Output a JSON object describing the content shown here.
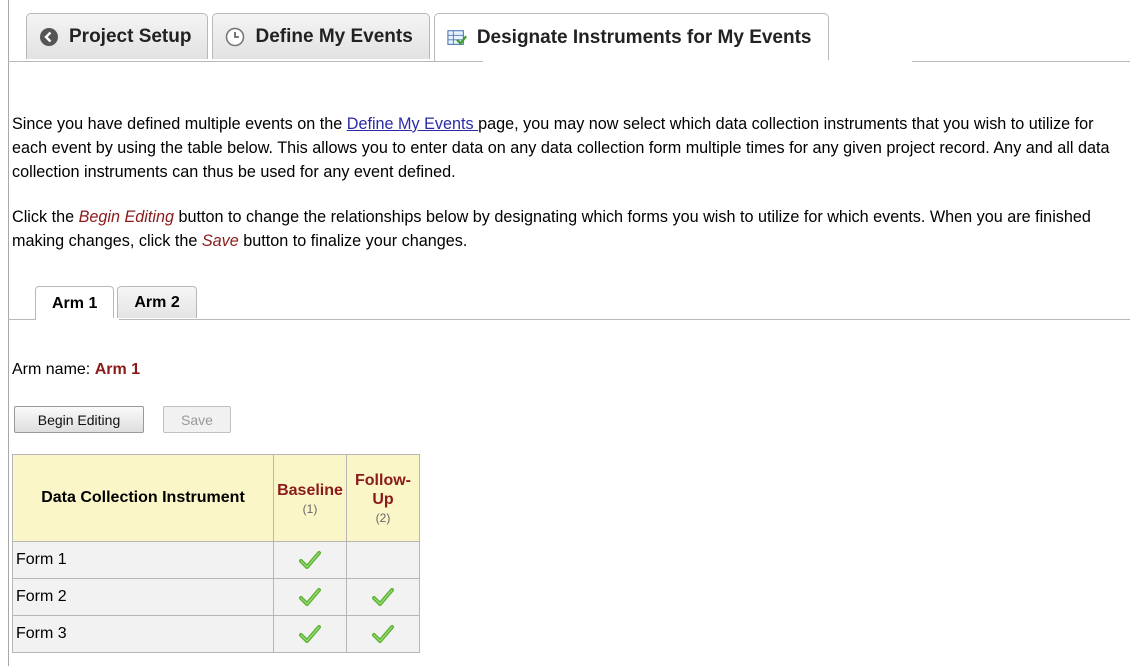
{
  "top_tabs": [
    {
      "label": "Project Setup",
      "icon": "arrow-left-circle-icon"
    },
    {
      "label": "Define My Events",
      "icon": "clock-icon"
    },
    {
      "label": "Designate Instruments for My Events",
      "icon": "instrument-grid-icon",
      "active": true
    }
  ],
  "intro": {
    "p1_before": "Since you have defined multiple events on the ",
    "p1_link": "Define My Events ",
    "p1_after": "page, you may now select which data collection instruments that you wish to utilize for each event by using the table below. This allows you to enter data on any data collection form multiple times for any given project record. Any and all data collection instruments can thus be used for any event defined.",
    "p2_a": "Click the ",
    "p2_em1": "Begin Editing",
    "p2_b": " button to change the relationships below by designating which forms you wish to utilize for which events. When you are finished making changes, click the ",
    "p2_em2": "Save",
    "p2_c": " button to finalize your changes."
  },
  "arm_tabs": [
    {
      "label": "Arm 1",
      "active": true
    },
    {
      "label": "Arm 2"
    }
  ],
  "arm": {
    "name_label": "Arm name:",
    "name": "Arm 1"
  },
  "buttons": {
    "begin_editing": "Begin Editing",
    "save": "Save"
  },
  "table": {
    "instrument_header": "Data Collection Instrument",
    "events": [
      {
        "name": "Baseline",
        "num": "(1)"
      },
      {
        "name": "Follow-\nUp",
        "num": "(2)"
      }
    ],
    "rows": [
      {
        "form": "Form 1",
        "checks": [
          true,
          false
        ]
      },
      {
        "form": "Form 2",
        "checks": [
          true,
          true
        ]
      },
      {
        "form": "Form 3",
        "checks": [
          true,
          true
        ]
      }
    ]
  },
  "colors": {
    "accent_red": "#8b1a1a",
    "header_bg": "#fbf6c8",
    "check_green": "#5db132"
  }
}
